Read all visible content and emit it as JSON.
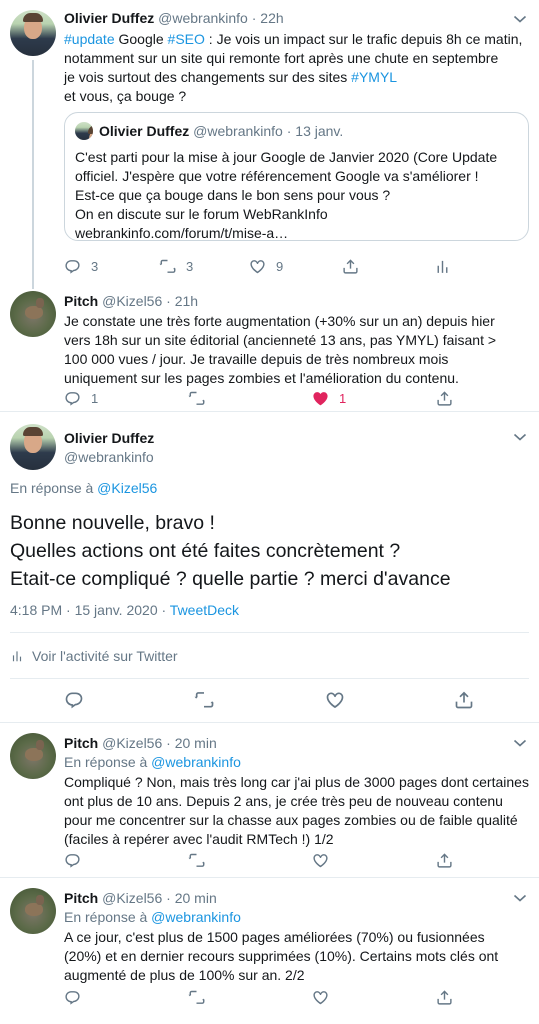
{
  "tweets": [
    {
      "name": "Olivier Duffez",
      "handle": "@webrankinfo",
      "time": "· 22h",
      "text_parts": {
        "tag_update": "#update",
        "t1": " Google ",
        "tag_seo": "#SEO",
        "t2": " : Je vois un impact sur le trafic depuis 8h ce matin, notamment sur un site qui remonte fort après une chute en septembre",
        "t3": "je vois surtout des changements sur des sites ",
        "tag_ymyl": "#YMYL",
        "t4": "et vous, ça bouge ?"
      },
      "quote": {
        "name": "Olivier Duffez",
        "handle": "@webrankinfo",
        "time": "· 13 janv.",
        "lines": [
          "C'est parti pour la mise à jour Google de Janvier 2020 (Core Update",
          "officiel. J'espère que votre référencement Google va s'améliorer !",
          "Est-ce que ça bouge dans le bon sens pour vous ?",
          "On en discute sur le forum WebRankInfo",
          "webrankinfo.com/forum/t/mise-a…"
        ]
      },
      "replies": "3",
      "retweets": "3",
      "likes": "9"
    },
    {
      "name": "Pitch",
      "handle": "@Kizel56",
      "time": "· 21h",
      "text": "Je constate une très forte augmentation (+30% sur un an) depuis hier vers 18h sur un site éditorial (ancienneté 13 ans, pas YMYL) faisant > 100 000 vues / jour. Je travaille depuis de très nombreux mois uniquement sur les pages zombies et l'amélioration du contenu.",
      "replies": "1",
      "likes": "1"
    }
  ],
  "main_tweet": {
    "name": "Olivier Duffez",
    "handle": "@webrankinfo",
    "reply_prefix": "En réponse à ",
    "reply_to": "@Kizel56",
    "lines": [
      "Bonne nouvelle, bravo !",
      "Quelles actions ont été faites concrètement ?",
      "Etait-ce compliqué ? quelle partie ? merci d'avance"
    ],
    "timestamp": "4:18 PM · 15 janv. 2020 · ",
    "source": "TweetDeck",
    "activity": "Voir l'activité sur Twitter"
  },
  "replies": [
    {
      "name": "Pitch",
      "handle": "@Kizel56",
      "time": "· 20 min",
      "reply_prefix": "En réponse à ",
      "reply_to": "@webrankinfo",
      "text": "Compliqué ? Non, mais très long car j'ai plus de 3000 pages dont certaines ont plus de 10 ans. Depuis 2 ans, je crée très peu de nouveau contenu pour me concentrer sur la chasse aux pages zombies ou de faible qualité (faciles à repérer avec l'audit RMTech !) 1/2"
    },
    {
      "name": "Pitch",
      "handle": "@Kizel56",
      "time": "· 20 min",
      "reply_prefix": "En réponse à ",
      "reply_to": "@webrankinfo",
      "text": "A ce jour, c'est plus de 1500 pages améliorées (70%) ou fusionnées (20%) et en dernier recours supprimées (10%). Certains mots clés ont augmenté de plus de 100% sur an. 2/2"
    }
  ],
  "colors": {
    "link": "#1b95e0",
    "muted": "#657786",
    "like_active": "#e0245e",
    "border": "#e6ecf0"
  },
  "icons": [
    "chevron-down-icon",
    "reply-icon",
    "retweet-icon",
    "like-icon",
    "share-icon",
    "analytics-icon"
  ]
}
